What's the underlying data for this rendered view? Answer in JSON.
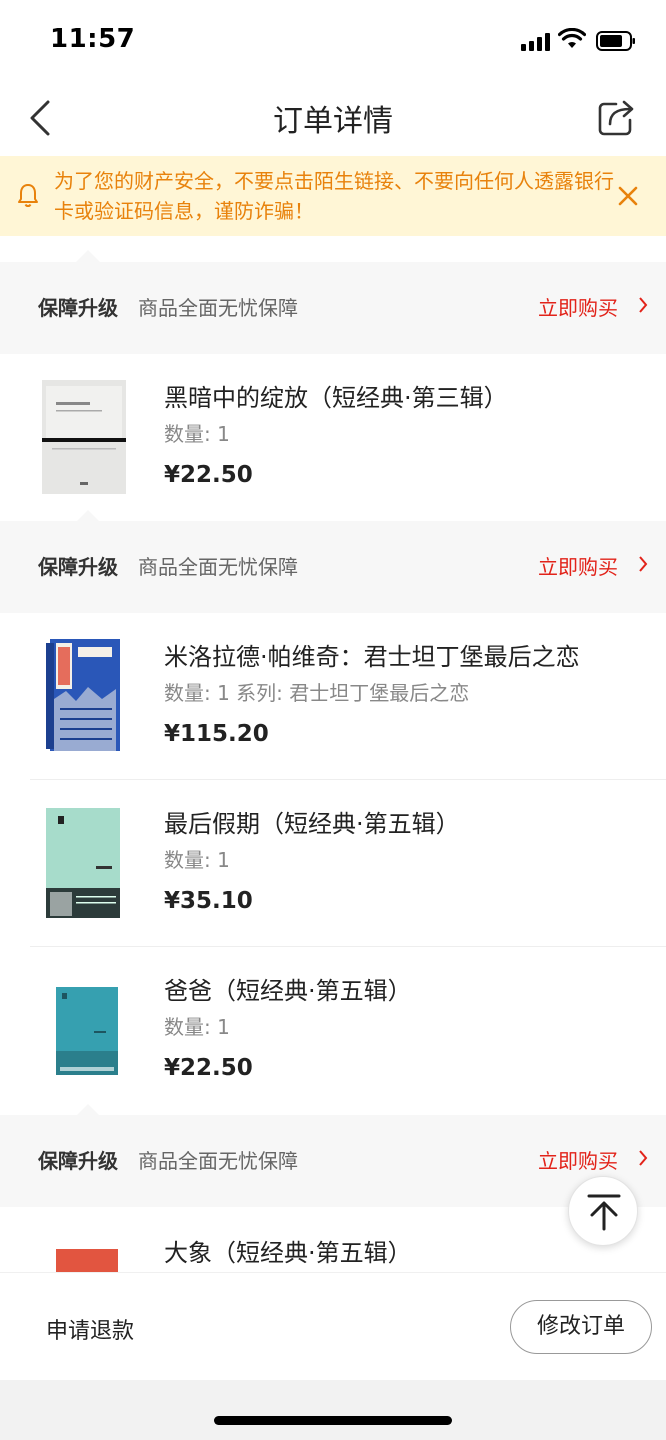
{
  "status_bar": {
    "time": "11:57"
  },
  "nav": {
    "title": "订单详情"
  },
  "notice": {
    "text": "为了您的财产安全，不要点击陌生链接、不要向任何人透露银行卡或验证码信息，谨防诈骗！"
  },
  "guarantee": {
    "title": "保障升级",
    "desc": "商品全面无忧保障",
    "buy_label": "立即购买"
  },
  "items": [
    {
      "name": "黑暗中的绽放（短经典·第三辑）",
      "qty": "数量: 1",
      "price": "¥22.50",
      "cover_color": "#e8e8e6",
      "cover_text": "黑暗中的绽放"
    },
    {
      "name": "米洛拉德·帕维奇：君士坦丁堡最后之恋",
      "qty": "数量: 1 系列: 君士坦丁堡最后之恋",
      "price": "¥115.20",
      "cover_color": "#2a57b8"
    },
    {
      "name": "最后假期（短经典·第五辑）",
      "qty": "数量: 1",
      "price": "¥35.10",
      "cover_color": "#a7dccb",
      "cover_text": "最后假期"
    },
    {
      "name": "爸爸（短经典·第五辑）",
      "qty": "数量: 1",
      "price": "¥22.50",
      "cover_color": "#36a0b0",
      "cover_text": "爸爸"
    },
    {
      "name": "大象（短经典·第五辑）",
      "cover_color": "#e25540"
    }
  ],
  "bottom": {
    "refund_label": "申请退款",
    "modify_label": "修改订单"
  }
}
